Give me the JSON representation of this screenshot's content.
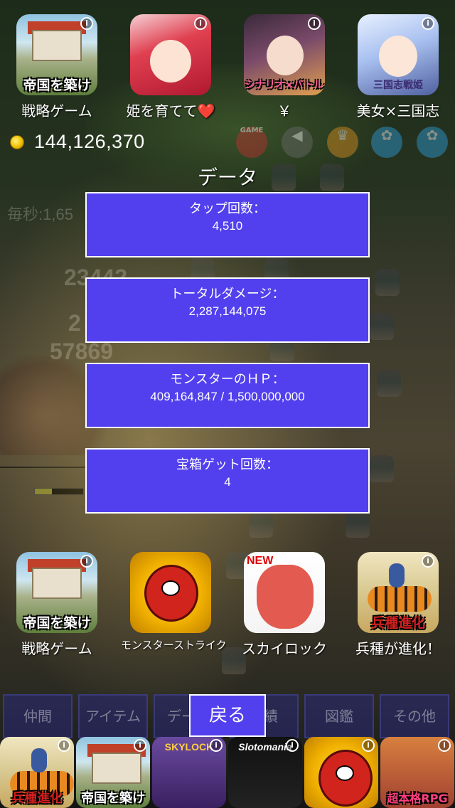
{
  "top_ads": [
    {
      "icon": "castle-app-icon",
      "caption": "帝国を築け",
      "label": "戦略ゲーム"
    },
    {
      "icon": "red-hair-girl-app-icon",
      "caption": "",
      "label": "姫を育てて❤️"
    },
    {
      "icon": "scenario-battle-app-icon",
      "caption": "シナリオ×バトル",
      "label": "￥"
    },
    {
      "icon": "three-kingdoms-girl-app-icon",
      "caption": "三国志戦姫",
      "label": "美女×三国志"
    }
  ],
  "coins": {
    "amount": "144,126,370"
  },
  "header_buttons": {
    "game": "GAME"
  },
  "background": {
    "per_second": "毎秒:1,65",
    "damage_1": "23442",
    "damage_2": "2",
    "damage_3": "57869"
  },
  "dialog": {
    "title": "データ",
    "stats": [
      {
        "key": "タップ回数：",
        "value": "4,510"
      },
      {
        "key": "トータルダメージ：",
        "value": "2,287,144,075"
      },
      {
        "key": "モンスターのＨＰ：",
        "value": "409,164,847 / 1,500,000,000"
      },
      {
        "key": "宝箱ゲット回数：",
        "value": "4"
      }
    ]
  },
  "bottom_ads": [
    {
      "icon": "castle-app-icon",
      "caption": "帝国を築け",
      "label": "戦略ゲーム"
    },
    {
      "icon": "monster-strike-app-icon",
      "caption": "",
      "label": "モンスターストライク"
    },
    {
      "icon": "sky-lock-app-icon",
      "caption": "NEW",
      "label": "スカイロック"
    },
    {
      "icon": "tiger-rider-app-icon",
      "caption": "兵種進化",
      "label": "兵種が進化！"
    }
  ],
  "tabs": [
    "仲間",
    "アイテム",
    "データ",
    "実績",
    "図鑑",
    "その他"
  ],
  "back_button": "戻る",
  "bottom_strip": [
    {
      "caption": "兵種進化"
    },
    {
      "caption": "帝国を築け"
    },
    {
      "title": "SKYLOCK"
    },
    {
      "title": "Slotomania"
    },
    {
      "caption": ""
    },
    {
      "caption": "超本格RPG"
    }
  ]
}
